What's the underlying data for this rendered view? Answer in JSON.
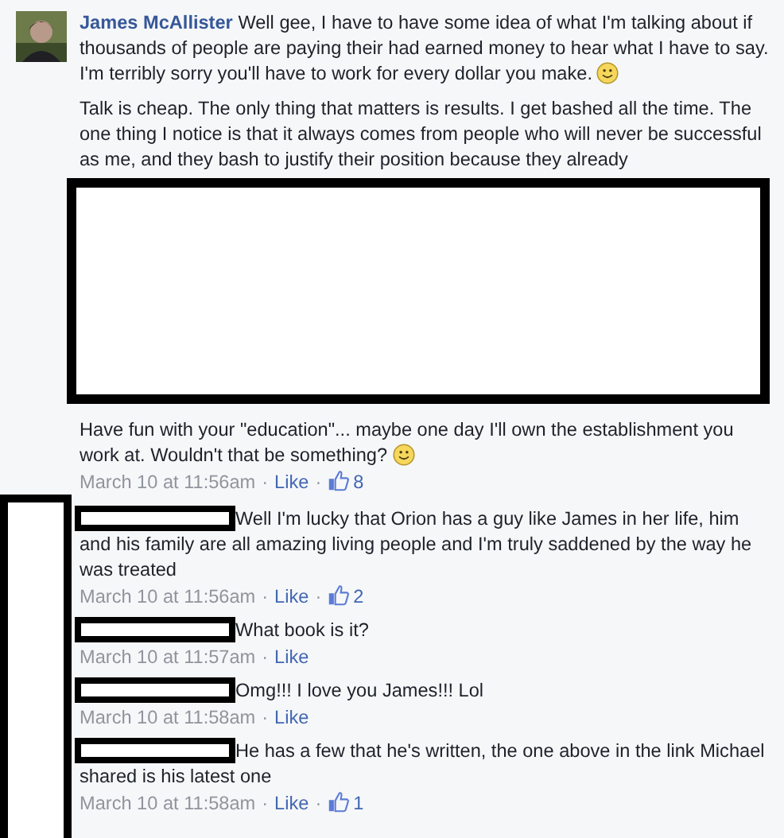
{
  "comment": {
    "author": "James McAllister",
    "author_redacted": false,
    "blocks": [
      {
        "kind": "text",
        "text": "Well gee, I have to have some idea of what I'm talking about if thousands of people are paying their had earned money to hear what I have to say. I'm terribly sorry you'll have to work for every dollar you make.",
        "smiley": true
      },
      {
        "kind": "text",
        "text": "Talk is cheap. The only thing that matters is results. I get bashed all the time. The one thing I notice is that it always comes from people who will never be successful as me, and they bash to justify their position because they already",
        "smiley": false
      },
      {
        "kind": "redaction"
      },
      {
        "kind": "text",
        "text": "Have fun with your \"education\"... maybe one day I'll own the establishment you work at. Wouldn't that be something?",
        "smiley": true
      }
    ],
    "meta": [
      {
        "kind": "time",
        "text": "March 10 at 11:56am"
      },
      {
        "kind": "sep",
        "text": "·"
      },
      {
        "kind": "link",
        "text": "Like"
      },
      {
        "kind": "sep",
        "text": "·"
      },
      {
        "kind": "likes",
        "text": "8"
      }
    ]
  },
  "replies": {
    "avatar_redacted": true,
    "items": [
      {
        "author_redacted": true,
        "blocks": [
          {
            "kind": "text",
            "text": "Well I'm lucky that Orion has a guy like James in her life, him and his family are all amazing living people and I'm truly saddened by the way he was treated",
            "smiley": false
          }
        ],
        "meta": [
          {
            "kind": "time",
            "text": "March 10 at 11:56am"
          },
          {
            "kind": "sep",
            "text": "·"
          },
          {
            "kind": "link",
            "text": "Like"
          },
          {
            "kind": "sep",
            "text": "·"
          },
          {
            "kind": "likes",
            "text": "2"
          }
        ]
      },
      {
        "author_redacted": true,
        "blocks": [
          {
            "kind": "text",
            "text": "What book is it?",
            "smiley": false
          }
        ],
        "meta": [
          {
            "kind": "time",
            "text": "March 10 at 11:57am"
          },
          {
            "kind": "sep",
            "text": "·"
          },
          {
            "kind": "link",
            "text": "Like"
          }
        ]
      },
      {
        "author_redacted": true,
        "blocks": [
          {
            "kind": "text",
            "text": "Omg!!! I love you James!!! Lol",
            "smiley": false
          }
        ],
        "meta": [
          {
            "kind": "time",
            "text": "March 10 at 11:58am"
          },
          {
            "kind": "sep",
            "text": "·"
          },
          {
            "kind": "link",
            "text": "Like"
          }
        ]
      },
      {
        "author_redacted": true,
        "blocks": [
          {
            "kind": "text",
            "text": "He has a few that he's written, the one above in the link Michael shared is his latest one",
            "smiley": false
          }
        ],
        "meta": [
          {
            "kind": "time",
            "text": "March 10 at 11:58am"
          },
          {
            "kind": "sep",
            "text": "·"
          },
          {
            "kind": "link",
            "text": "Like"
          },
          {
            "kind": "sep",
            "text": "·"
          },
          {
            "kind": "likes",
            "text": "1"
          }
        ]
      }
    ]
  }
}
